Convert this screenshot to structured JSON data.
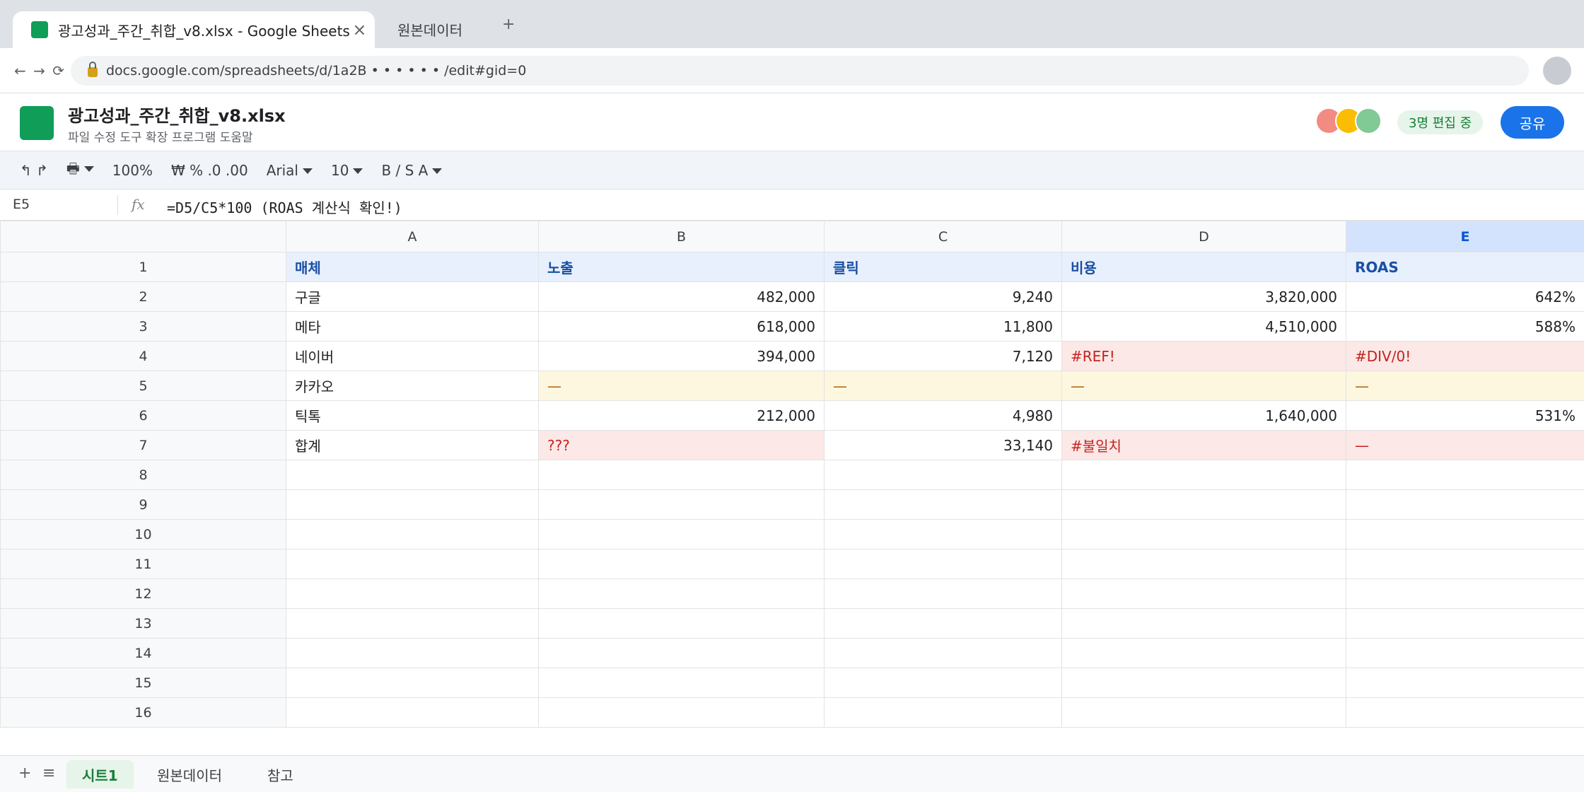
{
  "browser": {
    "active_tab_title": "광고성과_주간_취합_v8.xlsx - Google Sheets",
    "active_tab_close": "×",
    "inactive_tab_title": "원본데이터",
    "new_tab": "+",
    "nav": "← → ⟳",
    "url": "docs.google.com/spreadsheets/d/1a2B • • • • • • /edit#gid=0"
  },
  "doc": {
    "title": "광고성과_주간_취합_v8.xlsx",
    "menu": "파일 수정 도구 확장 프로그램 도움말",
    "editing_badge": "3명 편집 중",
    "share_label": "공유",
    "avatar_colors": [
      "#f28b82",
      "#fbbc04",
      "#81c995"
    ]
  },
  "toolbar": {
    "undo_redo": "↰ ↱",
    "print": "🖶",
    "zoom": "100%",
    "formats": "₩ % .0 .00",
    "font": "Arial",
    "font_size": "10",
    "text_format": "B / S A"
  },
  "formula_bar": {
    "cell_ref": "E5",
    "fx": "fx",
    "formula": "=D5/C5*100 (ROAS 계산식 확인!)"
  },
  "grid": {
    "columns": [
      "A",
      "B",
      "C",
      "D",
      "E"
    ],
    "selected_column": "E",
    "row_numbers": [
      "1",
      "2",
      "3",
      "4",
      "5",
      "6",
      "7",
      "8",
      "9",
      "10",
      "11",
      "12",
      "13",
      "14",
      "15",
      "16"
    ],
    "rows": [
      [
        "매체",
        "노출",
        "클릭",
        "비용",
        "ROAS"
      ],
      [
        "구글",
        "482,000",
        "9,240",
        "3,820,000",
        "642%"
      ],
      [
        "메타",
        "618,000",
        "11,800",
        "4,510,000",
        "588%"
      ],
      [
        "네이버",
        "394,000",
        "7,120",
        "#REF!",
        "#DIV/0!"
      ],
      [
        "카카오",
        "—",
        "—",
        "—",
        "—"
      ],
      [
        "틱톡",
        "212,000",
        "4,980",
        "1,640,000",
        "531%"
      ],
      [
        "합계",
        "???",
        "33,140",
        "#불일치",
        "—"
      ]
    ]
  },
  "sheets": {
    "add": "+",
    "list": "≡",
    "tabs": [
      "시트1",
      "원본데이터",
      "참고"
    ],
    "active": "시트1"
  },
  "colors": {
    "error_bg": "#fce8e6",
    "error_text": "#c5221f",
    "warning_bg": "#fef7e0",
    "header_bg": "#e8f0fe",
    "accent": "#1a73e8",
    "sheets_green": "#0f9d58"
  }
}
